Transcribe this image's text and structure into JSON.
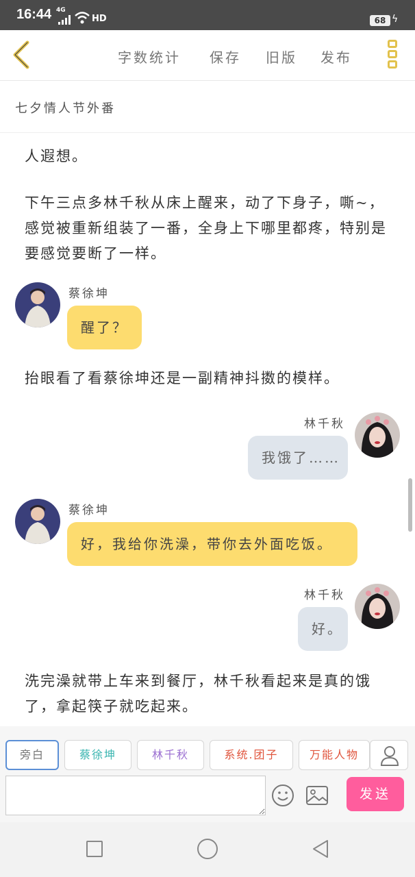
{
  "status_bar": {
    "time": "16:44",
    "network": "4G",
    "hd": "HD",
    "battery": "68"
  },
  "toolbar": {
    "word_count": "字数统计",
    "save": "保存",
    "old_version": "旧版",
    "publish": "发布",
    "accent_color": "#e2c24d"
  },
  "chapter": {
    "title": "七夕情人节外番"
  },
  "content": {
    "partial_line": "人遐想。",
    "para1": "下午三点多林千秋从床上醒来，动了下身子，嘶~，感觉被重新组装了一番，全身上下哪里都疼，特别是要感觉要断了一样。",
    "msg1": {
      "speaker": "蔡徐坤",
      "text": "醒了？"
    },
    "para2": "抬眼看了看蔡徐坤还是一副精神抖擞的模样。",
    "msg2": {
      "speaker": "林千秋",
      "text": "我饿了……"
    },
    "msg3": {
      "speaker": "蔡徐坤",
      "text": "好，我给你洗澡，带你去外面吃饭。"
    },
    "msg4": {
      "speaker": "林千秋",
      "text": "好。"
    },
    "para3": "洗完澡就带上车来到餐厅，林千秋看起来是真的饿了，拿起筷子就吃起来。"
  },
  "roles": [
    {
      "label": "旁白",
      "color": "#777777"
    },
    {
      "label": "蔡徐坤",
      "color": "#3ab5b0"
    },
    {
      "label": "林千秋",
      "color": "#9b6fd1"
    },
    {
      "label": "系统.团子",
      "color": "#e0553d"
    },
    {
      "label": "万能人物",
      "color": "#e0553d"
    }
  ],
  "composer": {
    "input_value": "",
    "send_label": "发送",
    "send_color": "#ff5d9d"
  }
}
